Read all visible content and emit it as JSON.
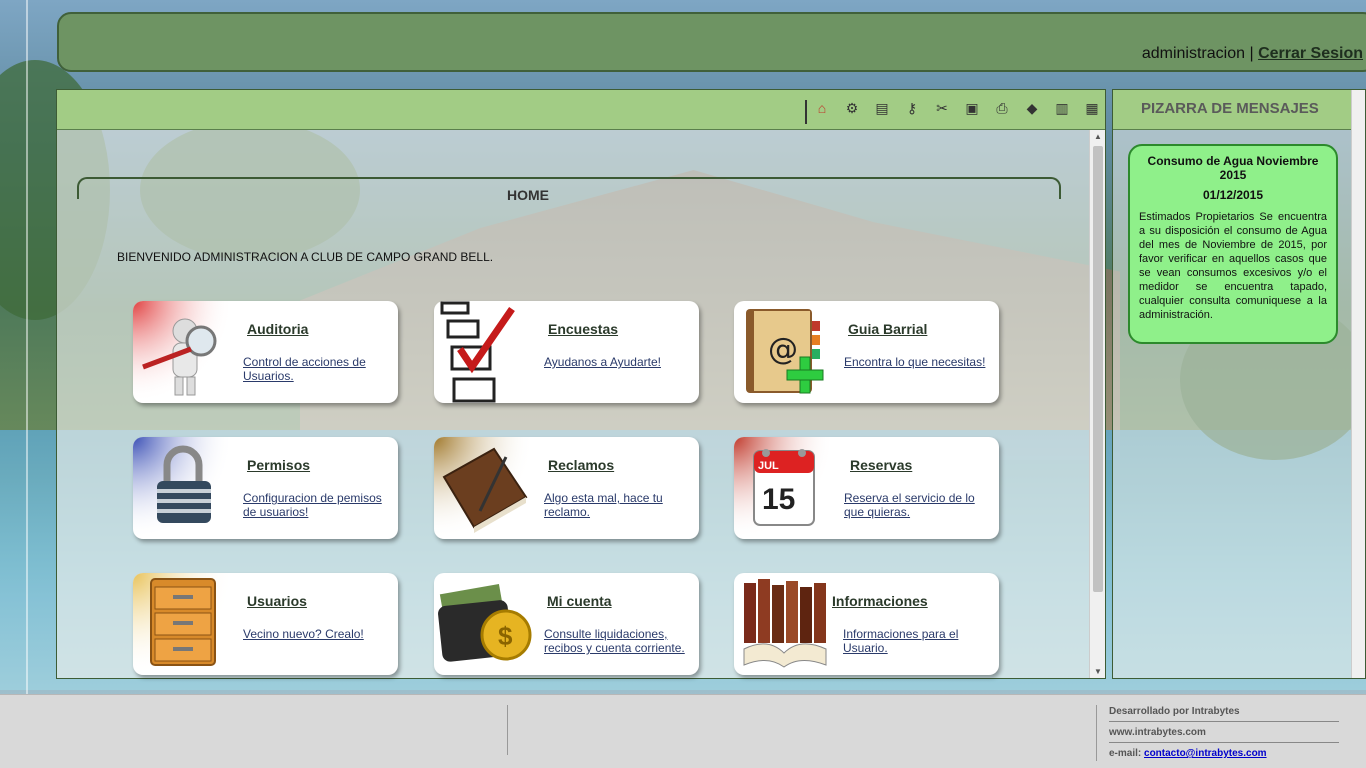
{
  "header": {
    "username": "administracion",
    "separator": "|",
    "logout_label": "Cerrar Sesion"
  },
  "toolbar": {
    "icons": [
      "home-icon",
      "gear-icon",
      "book-icon",
      "key-icon",
      "tools-icon",
      "save-icon",
      "print-icon",
      "book-icon",
      "document-icon",
      "calculator-icon"
    ]
  },
  "home": {
    "title": "HOME",
    "welcome": "BIENVENIDO ADMINISTRACION A CLUB DE CAMPO GRAND BELL."
  },
  "cards": [
    {
      "title": "Auditoria",
      "desc": "Control de acciones de Usuarios.",
      "icon": "magnifier-person-icon"
    },
    {
      "title": "Encuestas",
      "desc": "Ayudanos a Ayudarte!",
      "icon": "checklist-icon"
    },
    {
      "title": "Guia Barrial",
      "desc": "Encontra lo que necesitas!",
      "icon": "address-book-icon"
    },
    {
      "title": "Permisos",
      "desc": "Configuracion de pemisos de usuarios!",
      "icon": "padlock-icon"
    },
    {
      "title": "Reclamos",
      "desc": "Algo esta mal, hace tu reclamo.",
      "icon": "notebook-pen-icon"
    },
    {
      "title": "Reservas",
      "desc": "Reserva el servicio de lo que quieras.",
      "icon": "calendar-icon"
    },
    {
      "title": "Usuarios",
      "desc": "Vecino nuevo? Crealo!",
      "icon": "file-cabinet-icon"
    },
    {
      "title": "Mi cuenta",
      "desc": "Consulte liquidaciones, recibos y cuenta corriente.",
      "icon": "wallet-coin-icon"
    },
    {
      "title": "Informaciones",
      "desc": "Informaciones para el Usuario.",
      "icon": "books-icon"
    }
  ],
  "calendar": {
    "month": "JUL",
    "day": "15"
  },
  "board": {
    "title": "PIZARRA DE MENSAJES",
    "message": {
      "title": "Consumo de Agua Noviembre 2015",
      "date": "01/12/2015",
      "body": "Estimados Propietarios Se encuentra a su disposición el consumo de Agua del mes de Noviembre de 2015, por favor verificar en aquellos casos que se vean consumos excesivos y/o el medidor se encuentra tapado, cualquier consulta comuniquese a la administración."
    }
  },
  "footer": {
    "developer": "Desarrollado por Intrabytes",
    "website": "www.intrabytes.com",
    "email_label": "e-mail:",
    "email": "contacto@intrabytes.com"
  }
}
